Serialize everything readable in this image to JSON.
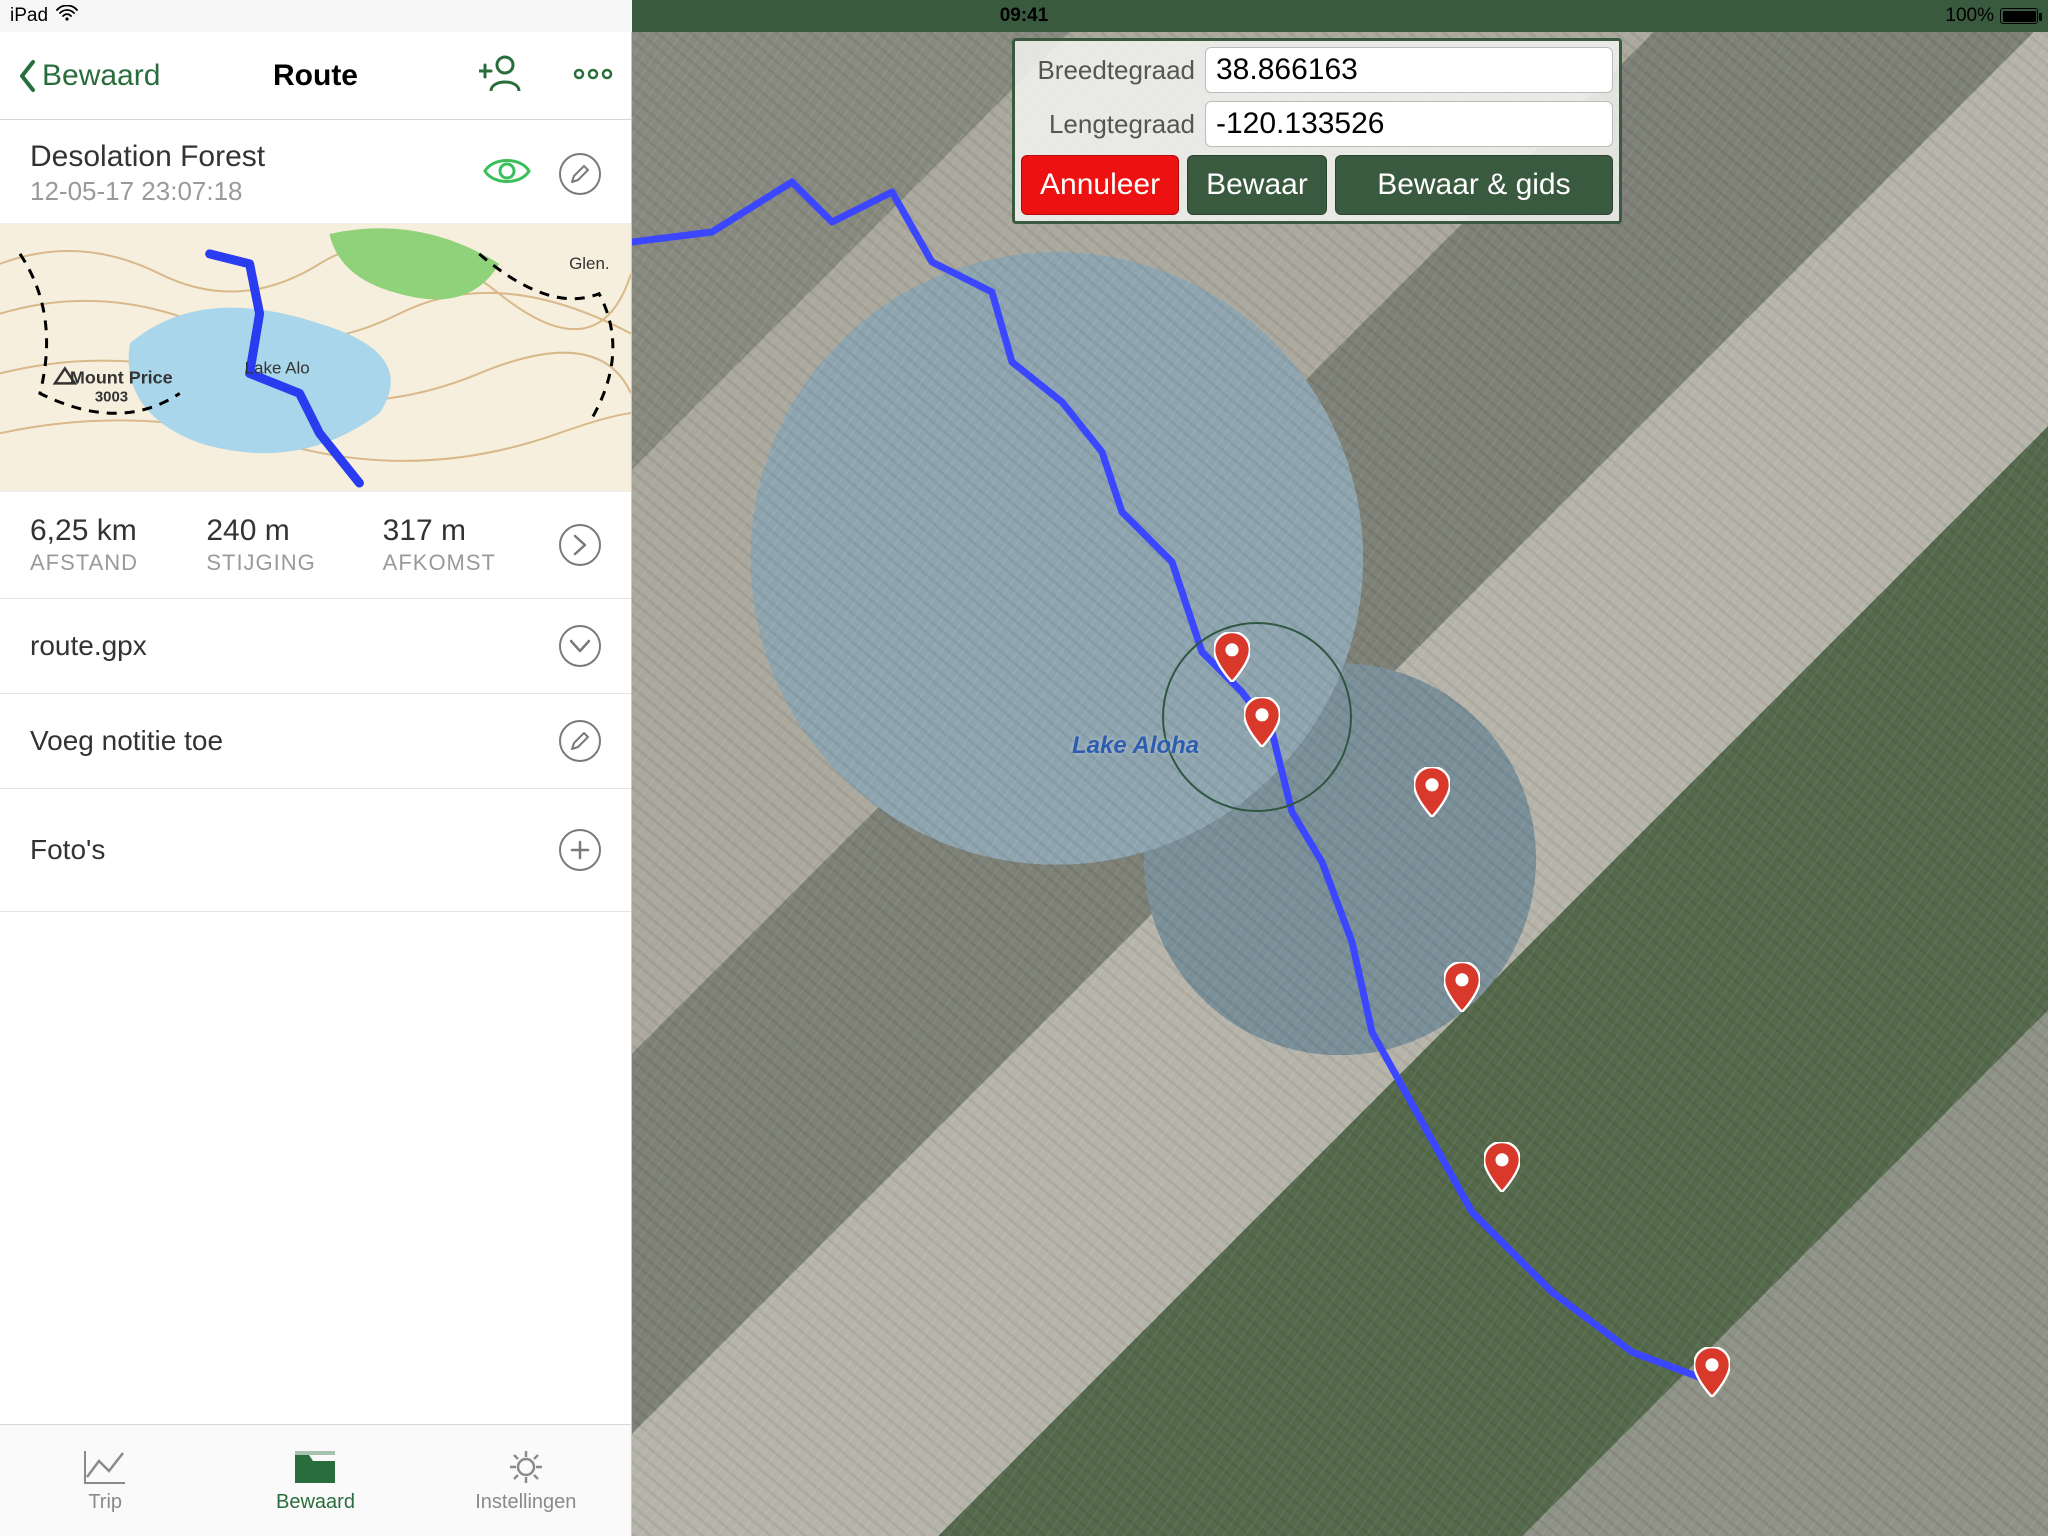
{
  "status": {
    "device": "iPad",
    "time": "09:41",
    "battery": "100%"
  },
  "nav": {
    "back": "Bewaard",
    "title": "Route"
  },
  "route": {
    "name": "Desolation Forest",
    "date": "12-05-17 23:07:18",
    "stats": {
      "distance": {
        "value": "6,25 km",
        "label": "AFSTAND"
      },
      "ascent": {
        "value": "240 m",
        "label": "STIJGING"
      },
      "descent": {
        "value": "317 m",
        "label": "AFKOMST"
      }
    },
    "file": "route.gpx",
    "add_note": "Voeg notitie toe",
    "photos": "Foto's"
  },
  "tabs": {
    "trip": "Trip",
    "saved": "Bewaard",
    "settings": "Instellingen"
  },
  "map": {
    "lake_label": "Lake Aloha",
    "mini": {
      "mount": "Mount Price",
      "mount_elev": "3003",
      "lake": "Lake Alo",
      "glen": "Glen."
    }
  },
  "panel": {
    "lat_label": "Breedtegraad",
    "lon_label": "Lengtegraad",
    "lat": "38.866163",
    "lon": "-120.133526",
    "cancel": "Annuleer",
    "save": "Bewaar",
    "save_guide": "Bewaar & gids"
  }
}
